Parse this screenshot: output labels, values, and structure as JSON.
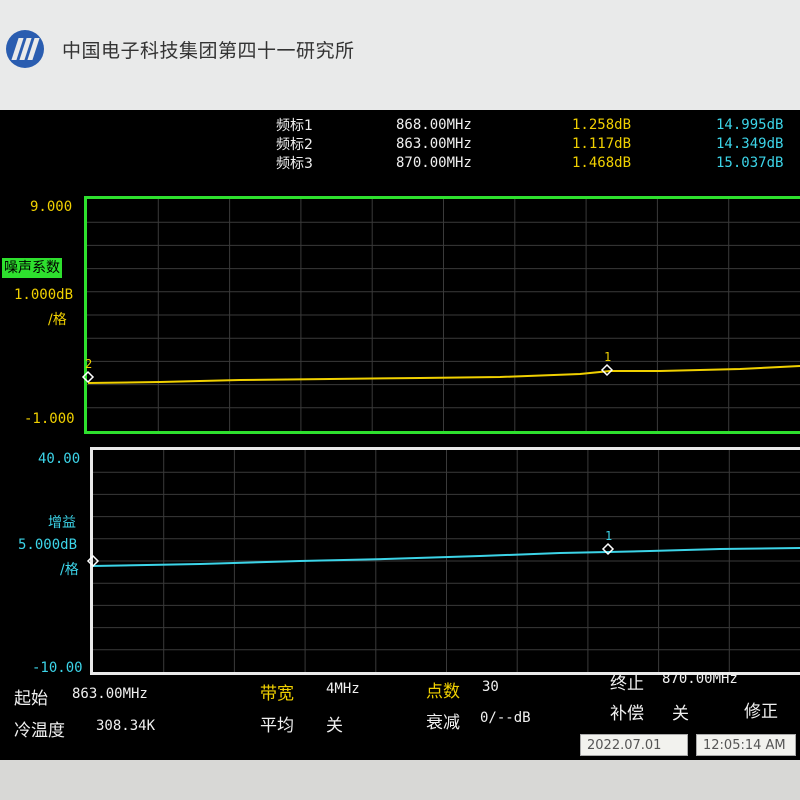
{
  "header": {
    "title": "中国电子科技集团第四十一研究所"
  },
  "markers": [
    {
      "label": "频标1",
      "freq": "868.00MHz",
      "nf": "1.258dB",
      "gain": "14.995dB"
    },
    {
      "label": "频标2",
      "freq": "863.00MHz",
      "nf": "1.117dB",
      "gain": "14.349dB"
    },
    {
      "label": "频标3",
      "freq": "870.00MHz",
      "nf": "1.468dB",
      "gain": "15.037dB"
    }
  ],
  "nf_plot": {
    "top": "9.000",
    "name": "噪声系数",
    "scale": "1.000dB",
    "per_div": "/格",
    "bottom": "-1.000",
    "marker_labels": [
      "2",
      "1"
    ],
    "color": "#f0d000",
    "border_color": "#2ee02e"
  },
  "gain_plot": {
    "top": "40.00",
    "name": "增益",
    "scale": "5.000dB",
    "per_div": "/格",
    "bottom": "-10.00",
    "marker_labels": [
      "1"
    ],
    "color": "#3cd4e8",
    "border_color": "#eaeaea"
  },
  "footer": {
    "start_label": "起始",
    "start_value": "863.00MHz",
    "bw_label": "带宽",
    "bw_value": "4MHz",
    "points_label": "点数",
    "points_value": "30",
    "stop_label": "终止",
    "stop_value": "870.00MHz",
    "cold_label": "冷温度",
    "cold_value": "308.34K",
    "avg_label": "平均",
    "avg_value": "关",
    "atten_label": "衰减",
    "atten_value": "0/--dB",
    "comp_label": "补偿",
    "comp_value": "关",
    "corr_label": "修正"
  },
  "status": {
    "date": "2022.07.01",
    "time": "12:05:14 AM"
  },
  "icons": {
    "logo": "cetc-logo-icon",
    "marker": "diamond-marker-icon"
  }
}
